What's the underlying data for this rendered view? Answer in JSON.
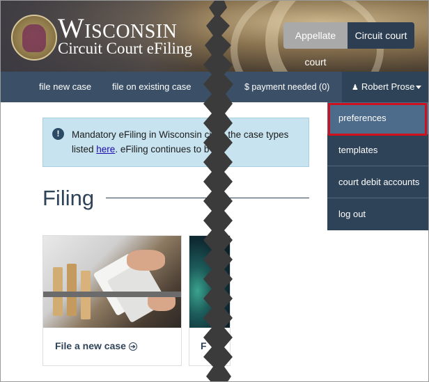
{
  "header": {
    "brand_title": "Wisconsin",
    "brand_subtitle": "Circuit Court eFiling",
    "court_toggle": {
      "appellate": "Appellate court",
      "circuit": "Circuit court"
    }
  },
  "nav": {
    "file_new_case": "file new case",
    "file_existing_case": "file on existing case",
    "payment_needed": "$ payment needed (0)",
    "user_name": "Robert Prose"
  },
  "user_menu": {
    "items": [
      {
        "label": "preferences"
      },
      {
        "label": "templates"
      },
      {
        "label": "court debit accounts"
      },
      {
        "label": "log out"
      }
    ]
  },
  "alert": {
    "text_part1": "Mandatory eFiling in Wisconsin ci",
    "text_part2": "the case types",
    "text_part3": "listed ",
    "link": "here",
    "text_part4": ". eFiling continues to b"
  },
  "main": {
    "heading": "Filing",
    "cards": [
      {
        "label": "File a new case"
      },
      {
        "label": "F"
      }
    ]
  }
}
